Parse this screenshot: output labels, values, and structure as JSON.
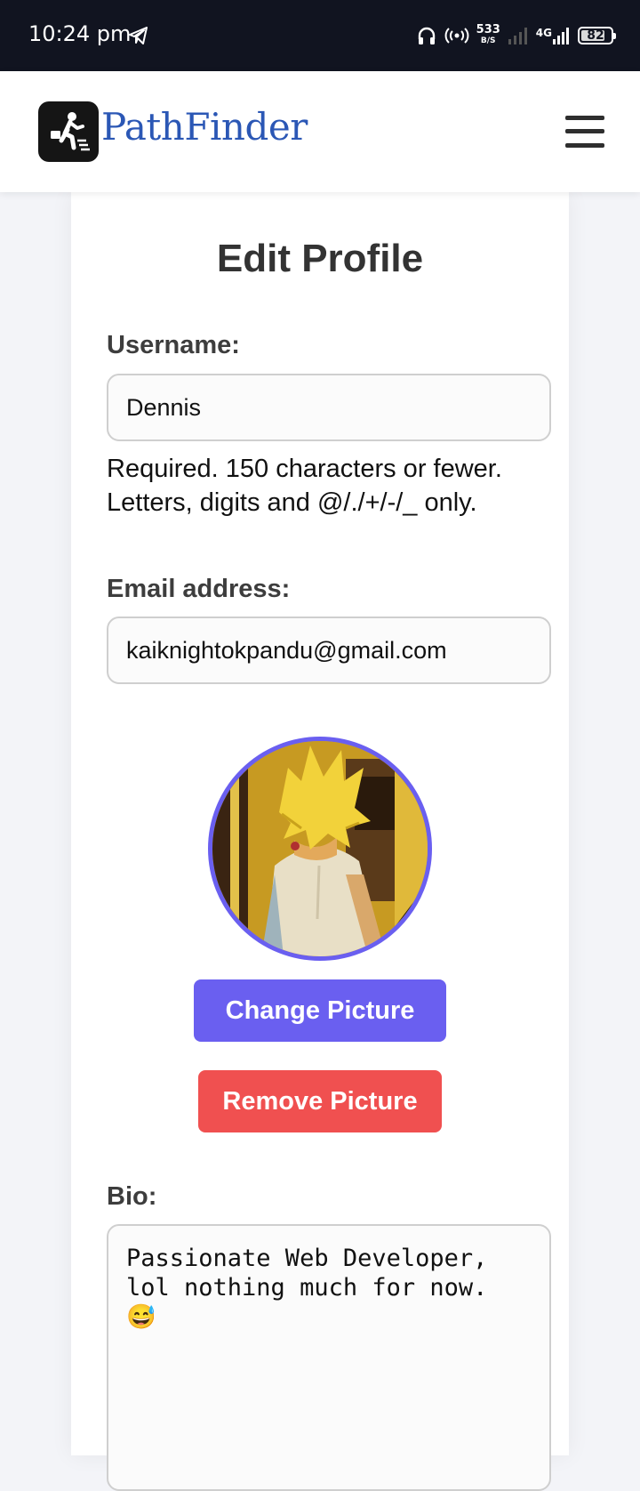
{
  "status_bar": {
    "time": "10:24 pm",
    "net_speed_value": "533",
    "net_speed_unit": "B/S",
    "network_type": "4G",
    "battery_level": "82",
    "battery_fraction": 0.82,
    "icons": [
      "telegram-icon",
      "headphones-icon",
      "hotspot-icon",
      "signal-icon",
      "battery-icon"
    ]
  },
  "header": {
    "brand": "PathFinder",
    "logo_icon": "walking-businessman-icon",
    "menu_icon": "hamburger-menu-icon"
  },
  "form": {
    "title": "Edit Profile",
    "username_label": "Username:",
    "username_value": "Dennis",
    "username_help": "Required. 150 characters or fewer. Letters, digits and @/./+/-/_ only.",
    "email_label": "Email address:",
    "email_value": "kaiknightokpandu@gmail.com",
    "change_picture_label": "Change Picture",
    "remove_picture_label": "Remove Picture",
    "bio_label": "Bio:",
    "bio_value": "Passionate Web Developer, lol nothing much for now. 😅"
  },
  "colors": {
    "accent": "#6a5ff0",
    "danger": "#f05050",
    "brand": "#2b57b5",
    "status_bar": "#111420"
  }
}
